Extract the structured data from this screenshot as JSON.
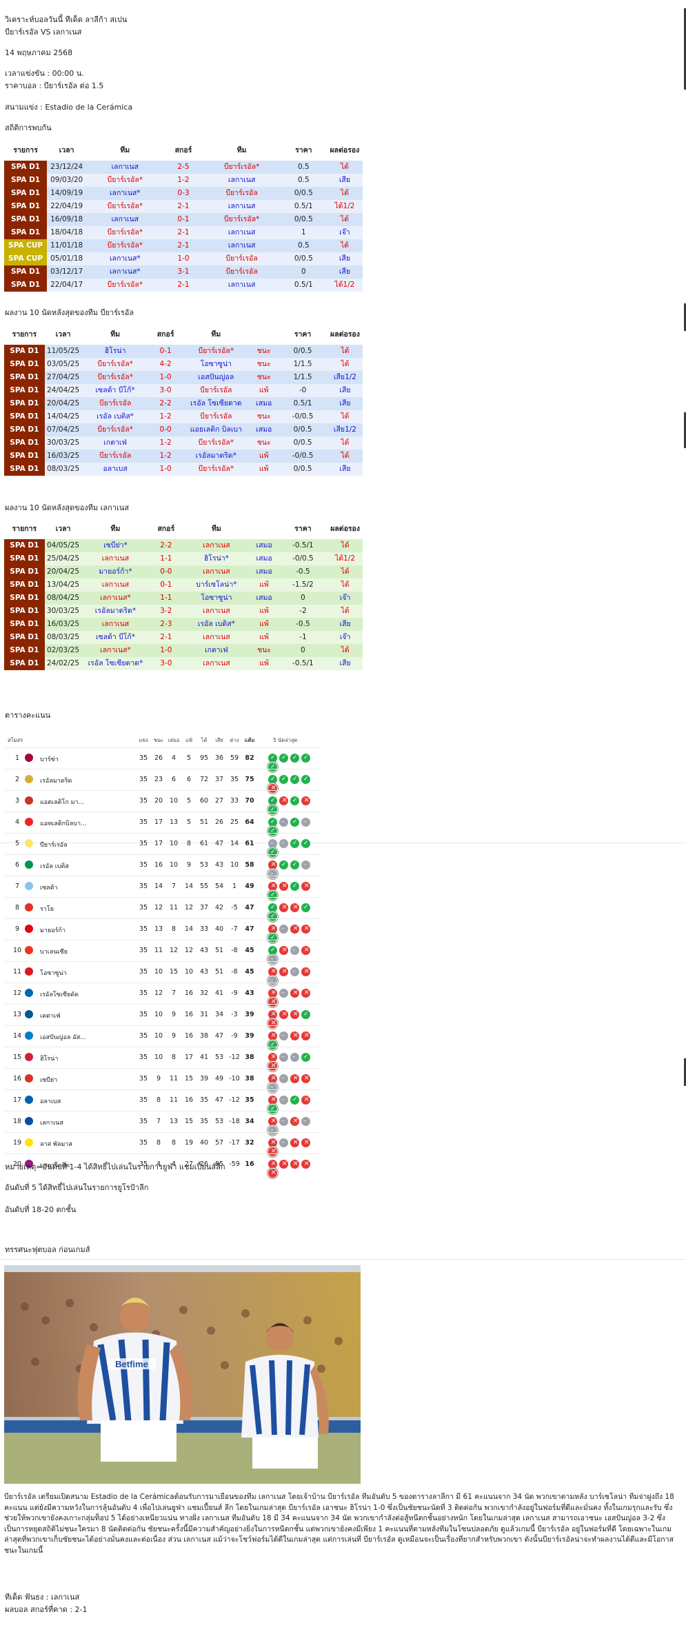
{
  "header": {
    "title": "วิเคราะห์บอลวันนี้ ทีเด็ด ลาลีก้า สเปน",
    "match": "บียาร์เรอัล VS เลกาเนส",
    "date": "14 พฤษภาคม 2568",
    "kickoff": "เวลาแข่งขัน : 00:00  น.",
    "odds": "ราคาบอล : บียาร์เรอัล  ต่อ 1.5",
    "stadium": "สนามแข่ง : Estadio de la Cerámica"
  },
  "h2h": {
    "heading": "สถิติการพบกัน",
    "columns": [
      "รายการ",
      "เวลา",
      "ทีม",
      "สกอร์",
      "ทีม",
      "ราคา",
      "ผลต่อรอง"
    ],
    "rows": [
      {
        "league": "SPA D1",
        "date": "23/12/24",
        "home": "เลกาเนส",
        "score": "2-5",
        "away": "บียาร์เรอัล*",
        "odds": "0.5",
        "result": "ได้"
      },
      {
        "league": "SPA D1",
        "date": "09/03/20",
        "home": "บียาร์เรอัล*",
        "score": "1-2",
        "away": "เลกาเนส",
        "odds": "0.5",
        "result": "เสีย"
      },
      {
        "league": "SPA D1",
        "date": "14/09/19",
        "home": "เลกาเนส*",
        "score": "0-3",
        "away": "บียาร์เรอัล",
        "odds": "0/0.5",
        "result": "ได้"
      },
      {
        "league": "SPA D1",
        "date": "22/04/19",
        "home": "บียาร์เรอัล*",
        "score": "2-1",
        "away": "เลกาเนส",
        "odds": "0.5/1",
        "result": "ได้1/2"
      },
      {
        "league": "SPA D1",
        "date": "16/09/18",
        "home": "เลกาเนส",
        "score": "0-1",
        "away": "บียาร์เรอัล*",
        "odds": "0/0.5",
        "result": "ได้"
      },
      {
        "league": "SPA D1",
        "date": "18/04/18",
        "home": "บียาร์เรอัล*",
        "score": "2-1",
        "away": "เลกาเนส",
        "odds": "1",
        "result": "เจ๊า"
      },
      {
        "league": "SPA CUP",
        "date": "11/01/18",
        "home": "บียาร์เรอัล*",
        "score": "2-1",
        "away": "เลกาเนส",
        "odds": "0.5",
        "result": "ได้"
      },
      {
        "league": "SPA CUP",
        "date": "05/01/18",
        "home": "เลกาเนส*",
        "score": "1-0",
        "away": "บียาร์เรอัล",
        "odds": "0/0.5",
        "result": "เสีย"
      },
      {
        "league": "SPA D1",
        "date": "03/12/17",
        "home": "เลกาเนส*",
        "score": "3-1",
        "away": "บียาร์เรอัล",
        "odds": "0",
        "result": "เสีย"
      },
      {
        "league": "SPA D1",
        "date": "22/04/17",
        "home": "บียาร์เรอัล*",
        "score": "2-1",
        "away": "เลกาเนส",
        "odds": "0.5/1",
        "result": "ได้1/2"
      }
    ]
  },
  "form_home": {
    "heading": "ผลงาน 10 นัดหลังสุดของทีม บียาร์เรอัล",
    "columns": [
      "รายการ",
      "เวลา",
      "ทีม",
      "สกอร์",
      "ทีม",
      "",
      "ราคา",
      "ผลต่อรอง"
    ],
    "rows": [
      {
        "league": "SPA D1",
        "date": "11/05/25",
        "home": "ฮิโรน่า",
        "score": "0-1",
        "away": "บียาร์เรอัล*",
        "wdl": "ชนะ",
        "odds": "0/0.5",
        "result": "ได้"
      },
      {
        "league": "SPA D1",
        "date": "03/05/25",
        "home": "บียาร์เรอัล*",
        "score": "4-2",
        "away": "โอซาซูน่า",
        "wdl": "ชนะ",
        "odds": "1/1.5",
        "result": "ได้"
      },
      {
        "league": "SPA D1",
        "date": "27/04/25",
        "home": "บียาร์เรอัล*",
        "score": "1-0",
        "away": "เอสปันญ่อล",
        "wdl": "ชนะ",
        "odds": "1/1.5",
        "result": "เสีย1/2"
      },
      {
        "league": "SPA D1",
        "date": "24/04/25",
        "home": "เซลต้า บีโก้*",
        "score": "3-0",
        "away": "บียาร์เรอัล",
        "wdl": "แพ้",
        "odds": "-0",
        "result": "เสีย"
      },
      {
        "league": "SPA D1",
        "date": "20/04/25",
        "home": "บียาร์เรอัล",
        "score": "2-2",
        "away": "เรอัล โซเซียดาด",
        "wdl": "เสมอ",
        "odds": "0.5/1",
        "result": "เสีย"
      },
      {
        "league": "SPA D1",
        "date": "14/04/25",
        "home": "เรอัล เบติส*",
        "score": "1-2",
        "away": "บียาร์เรอัล",
        "wdl": "ชนะ",
        "odds": "-0/0.5",
        "result": "ได้"
      },
      {
        "league": "SPA D1",
        "date": "07/04/25",
        "home": "บียาร์เรอัล*",
        "score": "0-0",
        "away": "แอธเลติก บิลเบา",
        "wdl": "เสมอ",
        "odds": "0/0.5",
        "result": "เสีย1/2"
      },
      {
        "league": "SPA D1",
        "date": "30/03/25",
        "home": "เกตาเฟ่",
        "score": "1-2",
        "away": "บียาร์เรอัล*",
        "wdl": "ชนะ",
        "odds": "0/0.5",
        "result": "ได้"
      },
      {
        "league": "SPA D1",
        "date": "16/03/25",
        "home": "บียาร์เรอัล",
        "score": "1-2",
        "away": "เรอัลมาดริด*",
        "wdl": "แพ้",
        "odds": "-0/0.5",
        "result": "ได้"
      },
      {
        "league": "SPA D1",
        "date": "08/03/25",
        "home": "อลาเบส",
        "score": "1-0",
        "away": "บียาร์เรอัล*",
        "wdl": "แพ้",
        "odds": "0/0.5",
        "result": "เสีย"
      }
    ]
  },
  "form_away": {
    "heading": "ผลงาน 10 นัดหลังสุดของทีม เลกาเนส",
    "columns": [
      "รายการ",
      "เวลา",
      "ทีม",
      "สกอร์",
      "ทีม",
      "",
      "ราคา",
      "ผลต่อรอง"
    ],
    "rows": [
      {
        "league": "SPA D1",
        "date": "04/05/25",
        "home": "เซบีย่า*",
        "score": "2-2",
        "away": "เลกาเนส",
        "wdl": "เสมอ",
        "odds": "-0.5/1",
        "result": "ได้"
      },
      {
        "league": "SPA D1",
        "date": "25/04/25",
        "home": "เลกาเนส",
        "score": "1-1",
        "away": "ฮิโรน่า*",
        "wdl": "เสมอ",
        "odds": "-0/0.5",
        "result": "ได้1/2"
      },
      {
        "league": "SPA D1",
        "date": "20/04/25",
        "home": "มายอร์ก้า*",
        "score": "0-0",
        "away": "เลกาเนส",
        "wdl": "เสมอ",
        "odds": "-0.5",
        "result": "ได้"
      },
      {
        "league": "SPA D1",
        "date": "13/04/25",
        "home": "เลกาเนส",
        "score": "0-1",
        "away": "บาร์เซโลน่า*",
        "wdl": "แพ้",
        "odds": "-1.5/2",
        "result": "ได้"
      },
      {
        "league": "SPA D1",
        "date": "08/04/25",
        "home": "เลกาเนส*",
        "score": "1-1",
        "away": "โอซาซูน่า",
        "wdl": "เสมอ",
        "odds": "0",
        "result": "เจ๊า"
      },
      {
        "league": "SPA D1",
        "date": "30/03/25",
        "home": "เรอัลมาดริด*",
        "score": "3-2",
        "away": "เลกาเนส",
        "wdl": "แพ้",
        "odds": "-2",
        "result": "ได้"
      },
      {
        "league": "SPA D1",
        "date": "16/03/25",
        "home": "เลกาเนส",
        "score": "2-3",
        "away": "เรอัล เบติส*",
        "wdl": "แพ้",
        "odds": "-0.5",
        "result": "เสีย"
      },
      {
        "league": "SPA D1",
        "date": "08/03/25",
        "home": "เซลต้า บีโก้*",
        "score": "2-1",
        "away": "เลกาเนส",
        "wdl": "แพ้",
        "odds": "-1",
        "result": "เจ๊า"
      },
      {
        "league": "SPA D1",
        "date": "02/03/25",
        "home": "เลกาเนส*",
        "score": "1-0",
        "away": "เกตาเฟ่",
        "wdl": "ชนะ",
        "odds": "0",
        "result": "ได้"
      },
      {
        "league": "SPA D1",
        "date": "24/02/25",
        "home": "เรอัล โซเซียดาด*",
        "score": "3-0",
        "away": "เลกาเนส",
        "wdl": "แพ้",
        "odds": "-0.5/1",
        "result": "เสีย"
      }
    ]
  },
  "standings": {
    "heading": "ตารางคะแนน",
    "columns": [
      "สโมสร",
      "แข่ง",
      "ชนะ",
      "เสมอ",
      "แพ้",
      "ได้",
      "เสีย",
      "ต่าง",
      "แต้ม",
      "5 นัดล่าสุด"
    ],
    "rows": [
      {
        "rank": "1",
        "team": "บาร์ซ่า",
        "p": "35",
        "w": "26",
        "d": "4",
        "l": "5",
        "gf": "95",
        "ga": "36",
        "gd": "59",
        "pts": "82",
        "form": [
          "W",
          "W",
          "W",
          "W",
          "W"
        ],
        "color": "#a50044"
      },
      {
        "rank": "2",
        "team": "เรอัลมาดริด",
        "p": "35",
        "w": "23",
        "d": "6",
        "l": "6",
        "gf": "72",
        "ga": "37",
        "gd": "35",
        "pts": "75",
        "form": [
          "W",
          "W",
          "W",
          "W",
          "L"
        ],
        "color": "#d4af37"
      },
      {
        "rank": "3",
        "team": "แอตเลติโก มา...",
        "p": "35",
        "w": "20",
        "d": "10",
        "l": "5",
        "gf": "60",
        "ga": "27",
        "gd": "33",
        "pts": "70",
        "form": [
          "W",
          "L",
          "W",
          "L",
          "W"
        ],
        "color": "#cb3524"
      },
      {
        "rank": "4",
        "team": "แอทเลติกบิลบา...",
        "p": "35",
        "w": "17",
        "d": "13",
        "l": "5",
        "gf": "51",
        "ga": "26",
        "gd": "25",
        "pts": "64",
        "form": [
          "W",
          "D",
          "W",
          "D",
          "W"
        ],
        "color": "#ee2523"
      },
      {
        "rank": "5",
        "team": "บียาร์เรอัล",
        "p": "35",
        "w": "17",
        "d": "10",
        "l": "8",
        "gf": "61",
        "ga": "47",
        "gd": "14",
        "pts": "61",
        "form": [
          "D",
          "D",
          "W",
          "W",
          "W"
        ],
        "color": "#ffe667"
      },
      {
        "rank": "6",
        "team": "เรอัล เบติส",
        "p": "35",
        "w": "16",
        "d": "10",
        "l": "9",
        "gf": "53",
        "ga": "43",
        "gd": "10",
        "pts": "58",
        "form": [
          "L",
          "W",
          "W",
          "D",
          "D"
        ],
        "color": "#00954c"
      },
      {
        "rank": "7",
        "team": "เซลต้า",
        "p": "35",
        "w": "14",
        "d": "7",
        "l": "14",
        "gf": "55",
        "ga": "54",
        "gd": "1",
        "pts": "49",
        "form": [
          "L",
          "L",
          "W",
          "L",
          "W"
        ],
        "color": "#8ac3ee"
      },
      {
        "rank": "8",
        "team": "ราโย",
        "p": "35",
        "w": "12",
        "d": "11",
        "l": "12",
        "gf": "37",
        "ga": "42",
        "gd": "-5",
        "pts": "47",
        "form": [
          "W",
          "L",
          "L",
          "W",
          "W"
        ],
        "color": "#e53027"
      },
      {
        "rank": "9",
        "team": "มายอร์ก้า",
        "p": "35",
        "w": "13",
        "d": "8",
        "l": "14",
        "gf": "33",
        "ga": "40",
        "gd": "-7",
        "pts": "47",
        "form": [
          "L",
          "D",
          "L",
          "L",
          "W"
        ],
        "color": "#e20613"
      },
      {
        "rank": "10",
        "team": "บาเลนเซีย",
        "p": "35",
        "w": "11",
        "d": "12",
        "l": "12",
        "gf": "43",
        "ga": "51",
        "gd": "-8",
        "pts": "45",
        "form": [
          "W",
          "L",
          "D",
          "L",
          "D"
        ],
        "color": "#ee3524"
      },
      {
        "rank": "11",
        "team": "โอซาซูน่า",
        "p": "35",
        "w": "10",
        "d": "15",
        "l": "10",
        "gf": "43",
        "ga": "51",
        "gd": "-8",
        "pts": "45",
        "form": [
          "L",
          "L",
          "D",
          "L",
          "D"
        ],
        "color": "#d91a21"
      },
      {
        "rank": "12",
        "team": "เรอัลโซเซียดัด",
        "p": "35",
        "w": "12",
        "d": "7",
        "l": "16",
        "gf": "32",
        "ga": "41",
        "gd": "-9",
        "pts": "43",
        "form": [
          "L",
          "D",
          "L",
          "L",
          "L"
        ],
        "color": "#0067b1"
      },
      {
        "rank": "13",
        "team": "เคตาเฟ่",
        "p": "35",
        "w": "10",
        "d": "9",
        "l": "16",
        "gf": "31",
        "ga": "34",
        "gd": "-3",
        "pts": "39",
        "form": [
          "L",
          "L",
          "L",
          "W",
          "L"
        ],
        "color": "#005999"
      },
      {
        "rank": "14",
        "team": "เอสปันญ่อล อัส...",
        "p": "35",
        "w": "10",
        "d": "9",
        "l": "16",
        "gf": "38",
        "ga": "47",
        "gd": "-9",
        "pts": "39",
        "form": [
          "L",
          "D",
          "L",
          "L",
          "W"
        ],
        "color": "#007fc8"
      },
      {
        "rank": "15",
        "team": "ฮิโรน่า",
        "p": "35",
        "w": "10",
        "d": "8",
        "l": "17",
        "gf": "41",
        "ga": "53",
        "gd": "-12",
        "pts": "38",
        "form": [
          "L",
          "D",
          "D",
          "W",
          "L"
        ],
        "color": "#cd2534"
      },
      {
        "rank": "16",
        "team": "เซบีย่า",
        "p": "35",
        "w": "9",
        "d": "11",
        "l": "15",
        "gf": "39",
        "ga": "49",
        "gd": "-10",
        "pts": "38",
        "form": [
          "L",
          "D",
          "L",
          "L",
          "D"
        ],
        "color": "#d8312b"
      },
      {
        "rank": "17",
        "team": "อลาเบส",
        "p": "35",
        "w": "8",
        "d": "11",
        "l": "16",
        "gf": "35",
        "ga": "47",
        "gd": "-12",
        "pts": "35",
        "form": [
          "L",
          "D",
          "W",
          "L",
          "W"
        ],
        "color": "#0761af"
      },
      {
        "rank": "18",
        "team": "เลกาเนส",
        "p": "35",
        "w": "7",
        "d": "13",
        "l": "15",
        "gf": "35",
        "ga": "53",
        "gd": "-18",
        "pts": "34",
        "form": [
          "L",
          "D",
          "L",
          "D",
          "D"
        ],
        "color": "#004fa3"
      },
      {
        "rank": "19",
        "team": "ลาส พัลมาส",
        "p": "35",
        "w": "8",
        "d": "8",
        "l": "19",
        "gf": "40",
        "ga": "57",
        "gd": "-17",
        "pts": "32",
        "form": [
          "L",
          "D",
          "L",
          "L",
          "L"
        ],
        "color": "#ffe400"
      },
      {
        "rank": "20",
        "team": "บายาโดลิด",
        "p": "35",
        "w": "4",
        "d": "4",
        "l": "27",
        "gf": "26",
        "ga": "85",
        "gd": "-59",
        "pts": "16",
        "form": [
          "L",
          "L",
          "L",
          "L",
          "L"
        ],
        "color": "#921b88"
      }
    ]
  },
  "notes": {
    "n1": "หมายเหตุ=อันดับที่ 1-4 ได้สิทธิ์ไปเล่นในรายการยูฟ่า แชมเปี้ยนส์ลีก",
    "n2": "อันดับที่ 5 ได้สิทธิ์ไปเล่นในรายการยูโรป้าลีก",
    "n3": "อันดับที่ 18-20 ตกชั้น"
  },
  "preview": {
    "heading": "ทรรศนะฟุตบอล ก่อนเกมส์",
    "photo_shirt_text": "Betfime",
    "paragraph": "บียาร์เรอัล เตรียมเปิดสนาม Estadio de la Cerámicaต้อนรับการมาเยือนของทีม เลกาเนส โดยเจ้าบ้าน บียาร์เรอัล ทีมอันดับ 5 ของตารางลาลีกา มี 61 คะแนนจาก 34 นัด พวกเขาตามหลัง บาร์เซโลน่า ทีมจ่าฝูงถึง 18 คะแนน แต่ยังมีความหวังในการลุ้นอันดับ 4 เพื่อไปเล่นยูฟ่า แชมเปี้ยนส์ ลีก โดยในเกมล่าสุด บียาร์เรอัล เอาชนะ ฮิโรน่า 1-0 ซึ่งเป็นชัยชนะนัดที่ 3 ติดต่อกัน พวกเขากำลังอยู่ในฟอร์มที่ดีและมั่นคง ทั้งในเกมรุกและรับ ซึ่งช่วยให้พวกเขายังคงเกาะกลุ่มท็อป 5 ได้อย่างเหนียวแน่น ทางฝั่ง เลกาเนส ทีมอันดับ 18 มี 34 คะแนนจาก 34 นัด พวกเขากำลังต่อสู้หนีตกชั้นอย่างหนัก โดยในเกมล่าสุด เลกาเนส สามารถเอาชนะ เอสปันญ่อล 3-2 ซึ่งเป็นการหยุดสถิติไม่ชนะใครมา 8 นัดติดต่อกัน ชัยชนะครั้งนี้มีความสำคัญอย่างยิ่งในการหนีตกชั้น แต่พวกเขายังคงมีเพียง 1 คะแนนที่ตามหลังทีมในโซนปลอดภัย ดูแล้วเกมนี้ บียาร์เรอัล อยู่ในฟอร์มที่ดี โดยเฉพาะในเกมล่าสุดที่พวกเขาเก็บชัยชนะได้อย่างมั่นคงและต่อเนื่อง ส่วน เลกาเนส แม้ว่าจะโชว์ฟอร์มได้ดีในเกมล่าสุด แต่การเล่นที่ บียาร์เรอัล ดูเหมือนจะเป็นเรื่องที่ยากสำหรับพวกเขา ดังนั้นบียาร์เรอัลน่าจะทำผลงานได้ดีและมีโอกาสชนะในเกมนี้"
  },
  "tip": {
    "pick": "ทีเด็ด ฟันธง : เลกาเนส",
    "score": "ผลบอล สกอร์ที่คาด : 2-1"
  }
}
